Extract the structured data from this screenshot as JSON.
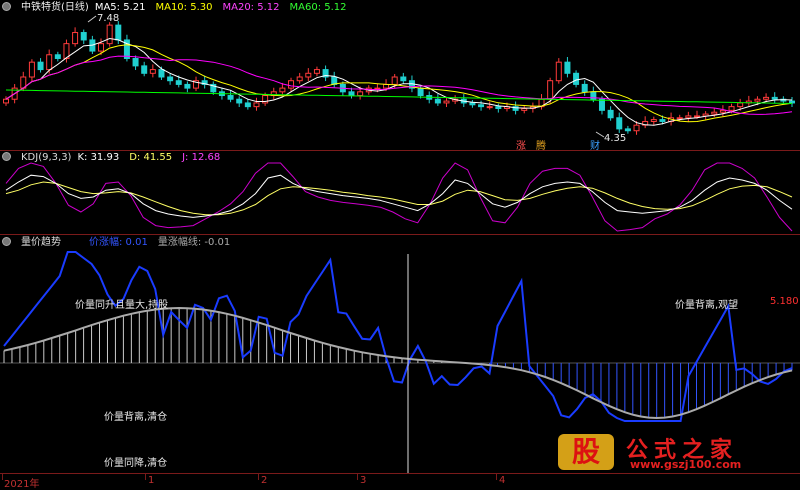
{
  "header": {
    "title": "中铁特货(日线)",
    "ma5": "MA5: 5.21",
    "ma10": "MA10: 5.30",
    "ma20": "MA20: 5.12",
    "ma60": "MA60: 5.12",
    "high_label": "7.48",
    "low_label": "4.35",
    "tag_zhang": "涨",
    "tag_teng": "腾",
    "tag_cai": "财"
  },
  "kdj": {
    "title": "KDJ(9,3,3)",
    "k": "K: 31.93",
    "d": "D: 41.55",
    "j": "J: 12.68"
  },
  "trend": {
    "title": "量价趋势",
    "line1": "价涨幅: 0.01",
    "line2": "量涨幅线: -0.01",
    "value_right": "5.180",
    "annotations": {
      "a1": "价量同升且量大,持股",
      "a2": "价量背离,观望",
      "a3": "价量背离,清仓",
      "a4": "价量同降,清仓"
    }
  },
  "axis": {
    "labels": [
      "2021年",
      "1",
      "2",
      "3",
      "4"
    ]
  },
  "logo": {
    "char": "股",
    "title": "公式之家",
    "url": "www.gszj100.com"
  },
  "colors": {
    "background": "#000000",
    "up": "#ff3b3b",
    "down": "#20d0d0",
    "ma5": "#ffffff",
    "ma10": "#ffff00",
    "ma20": "#ff00ff",
    "ma60": "#00ff00",
    "kdj_k": "#ffffff",
    "kdj_d": "#ffff66",
    "kdj_j": "#dd00dd",
    "trend_blue": "#1a3cff",
    "trend_gray": "#aaaaaa",
    "grid": "#7a1a1a"
  },
  "chart_data": {
    "type": "line",
    "note_series": "approximate visual reconstruction",
    "price_range": [
      4.35,
      7.48
    ],
    "price_close": [
      5.3,
      5.6,
      5.9,
      6.3,
      6.1,
      6.5,
      6.4,
      6.8,
      7.1,
      6.9,
      6.6,
      6.8,
      7.3,
      6.9,
      6.4,
      6.2,
      6.0,
      6.1,
      5.9,
      5.8,
      5.7,
      5.6,
      5.8,
      5.7,
      5.5,
      5.4,
      5.3,
      5.2,
      5.1,
      5.2,
      5.4,
      5.5,
      5.6,
      5.8,
      5.9,
      6.0,
      6.1,
      5.9,
      5.7,
      5.5,
      5.4,
      5.5,
      5.6,
      5.6,
      5.7,
      5.9,
      5.8,
      5.6,
      5.4,
      5.3,
      5.2,
      5.25,
      5.3,
      5.2,
      5.15,
      5.1,
      5.1,
      5.05,
      5.1,
      5.0,
      5.05,
      5.1,
      5.3,
      5.8,
      6.3,
      6.0,
      5.7,
      5.5,
      5.3,
      5.0,
      4.8,
      4.5,
      4.45,
      4.6,
      4.7,
      4.75,
      4.7,
      4.8,
      4.8,
      4.85,
      4.85,
      4.9,
      4.95,
      5.0,
      5.1,
      5.2,
      5.25,
      5.3,
      5.35,
      5.3,
      5.25,
      5.2
    ],
    "kdj_k": [
      60,
      72,
      82,
      80,
      70,
      55,
      48,
      50,
      60,
      62,
      55,
      40,
      30,
      25,
      22,
      20,
      22,
      25,
      30,
      40,
      55,
      78,
      82,
      70,
      62,
      58,
      55,
      52,
      50,
      48,
      45,
      40,
      35,
      30,
      40,
      55,
      75,
      70,
      55,
      40,
      35,
      42,
      55,
      65,
      70,
      72,
      70,
      58,
      42,
      30,
      28,
      26,
      28,
      30,
      35,
      45,
      60,
      72,
      78,
      75,
      70,
      60,
      45,
      32
    ],
    "kdj_d": [
      55,
      60,
      68,
      72,
      70,
      64,
      58,
      55,
      56,
      58,
      56,
      50,
      43,
      36,
      30,
      26,
      24,
      24,
      26,
      31,
      39,
      52,
      62,
      65,
      64,
      62,
      60,
      57,
      55,
      52,
      50,
      47,
      43,
      39,
      39,
      44,
      54,
      60,
      58,
      52,
      46,
      45,
      48,
      54,
      59,
      63,
      65,
      63,
      56,
      48,
      41,
      36,
      33,
      32,
      33,
      37,
      45,
      54,
      62,
      66,
      67,
      65,
      58,
      50
    ],
    "kdj_j": [
      70,
      92,
      100,
      95,
      70,
      38,
      28,
      40,
      70,
      72,
      52,
      20,
      8,
      5,
      6,
      8,
      18,
      28,
      40,
      58,
      85,
      100,
      100,
      80,
      58,
      50,
      45,
      42,
      40,
      38,
      35,
      28,
      18,
      12,
      40,
      78,
      100,
      90,
      50,
      15,
      12,
      35,
      70,
      88,
      92,
      92,
      82,
      50,
      15,
      0,
      2,
      5,
      18,
      25,
      38,
      60,
      90,
      100,
      100,
      92,
      78,
      50,
      20,
      0
    ]
  }
}
